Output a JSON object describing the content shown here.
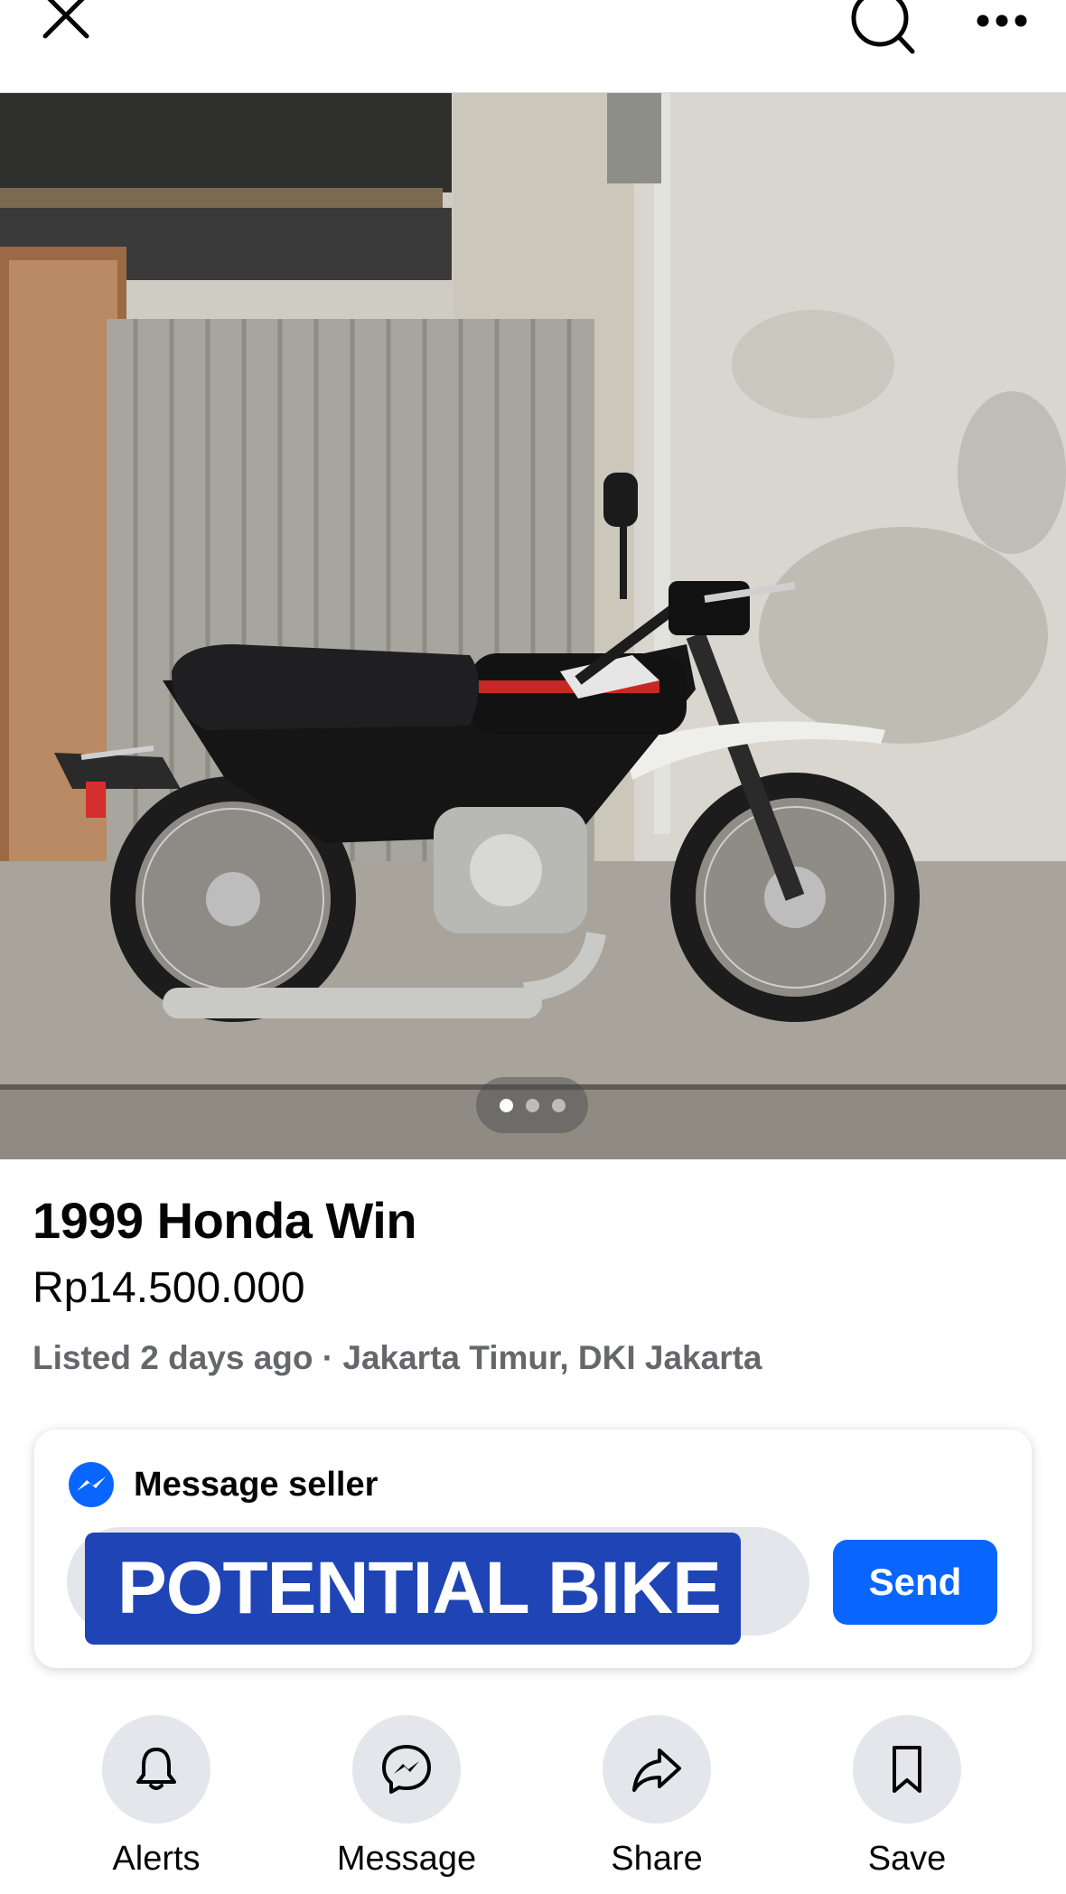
{
  "header": {
    "close_icon": "close-icon",
    "search_icon": "search-icon",
    "more_icon": "more-horizontal-icon"
  },
  "gallery": {
    "photo_description": "Black 1999 Honda Win motorcycle parked in front of a weathered wall",
    "image_count": 3,
    "active_index": 0
  },
  "listing": {
    "title": "1999 Honda Win",
    "price": "Rp14.500.000",
    "meta": "Listed 2 days ago · Jakarta Timur, DKI Jakarta"
  },
  "message": {
    "heading": "Message seller",
    "heading_icon": "messenger-icon",
    "input_value": "POTENTIAL BIKE",
    "send_label": "Send"
  },
  "actions": [
    {
      "label": "Alerts",
      "icon": "bell-icon"
    },
    {
      "label": "Message",
      "icon": "messenger-icon"
    },
    {
      "label": "Share",
      "icon": "share-icon"
    },
    {
      "label": "Save",
      "icon": "bookmark-icon"
    }
  ],
  "colors": {
    "accent": "#0866ff",
    "redaction": "#1e44b5",
    "secondary_text": "#65676b",
    "circle_bg": "#e4e6eb"
  }
}
